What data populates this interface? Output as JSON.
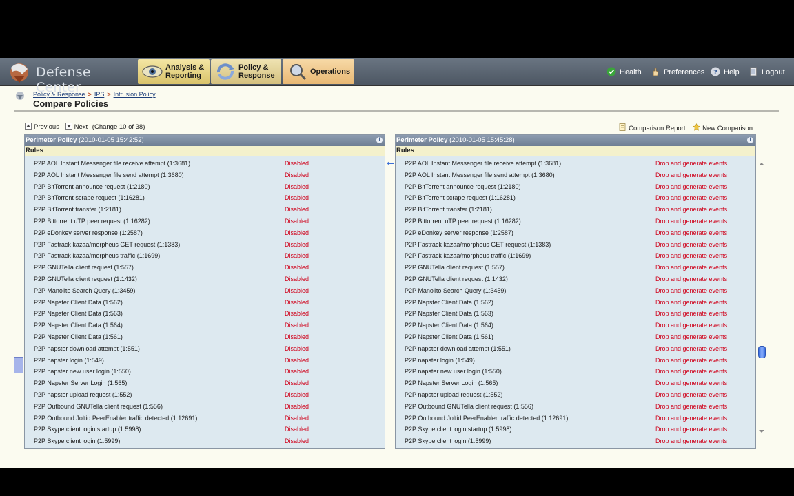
{
  "header": {
    "logo_text": "Defense Center",
    "nav": [
      {
        "label1": "Analysis &",
        "label2": "Reporting",
        "icon": "eye-icon"
      },
      {
        "label1": "Policy &",
        "label2": "Response",
        "icon": "refresh-icon"
      },
      {
        "label1": "Operations",
        "label2": "",
        "icon": "magnifier-icon"
      }
    ],
    "links": [
      {
        "label": "Health",
        "icon": "check-circle-icon"
      },
      {
        "label": "Preferences",
        "icon": "hand-icon"
      },
      {
        "label": "Help",
        "icon": "question-icon"
      },
      {
        "label": "Logout",
        "icon": "door-icon"
      }
    ]
  },
  "breadcrumb": [
    "Policy & Response",
    "IPS",
    "Intrusion Policy"
  ],
  "page_title": "Compare Policies",
  "pager": {
    "previous": "Previous",
    "next": "Next",
    "change": "(Change 10 of 38)"
  },
  "actions": {
    "comparison_report": "Comparison Report",
    "new_comparison": "New Comparison"
  },
  "left_panel": {
    "policy_name": "Perimeter Policy",
    "timestamp": "(2010-01-05 15:42:52)",
    "rules_label": "Rules",
    "state": "Disabled"
  },
  "right_panel": {
    "policy_name": "Perimeter Policy",
    "timestamp": "(2010-01-05 15:45:28)",
    "rules_label": "Rules",
    "state": "Drop and generate events"
  },
  "rules": [
    "P2P AOL Instant Messenger file receive attempt (1:3681)",
    "P2P AOL Instant Messenger file send attempt (1:3680)",
    "P2P BitTorrent announce request (1:2180)",
    "P2P BitTorrent scrape request (1:16281)",
    "P2P BitTorrent transfer (1:2181)",
    "P2P Bittorrent uTP peer request (1:16282)",
    "P2P eDonkey server response (1:2587)",
    "P2P Fastrack kazaa/morpheus GET request (1:1383)",
    "P2P Fastrack kazaa/morpheus traffic (1:1699)",
    "P2P GNUTella client request (1:557)",
    "P2P GNUTella client request (1:1432)",
    "P2P Manolito Search Query (1:3459)",
    "P2P Napster Client Data (1:562)",
    "P2P Napster Client Data (1:563)",
    "P2P Napster Client Data (1:564)",
    "P2P Napster Client Data (1:561)",
    "P2P napster download attempt (1:551)",
    "P2P napster login (1:549)",
    "P2P napster new user login (1:550)",
    "P2P Napster Server Login (1:565)",
    "P2P napster upload request (1:552)",
    "P2P Outbound GNUTella client request (1:556)",
    "P2P Outbound Joltid PeerEnabler traffic detected (1:12691)",
    "P2P Skype client login startup (1:5998)",
    "P2P Skype client login (1:5999)"
  ]
}
